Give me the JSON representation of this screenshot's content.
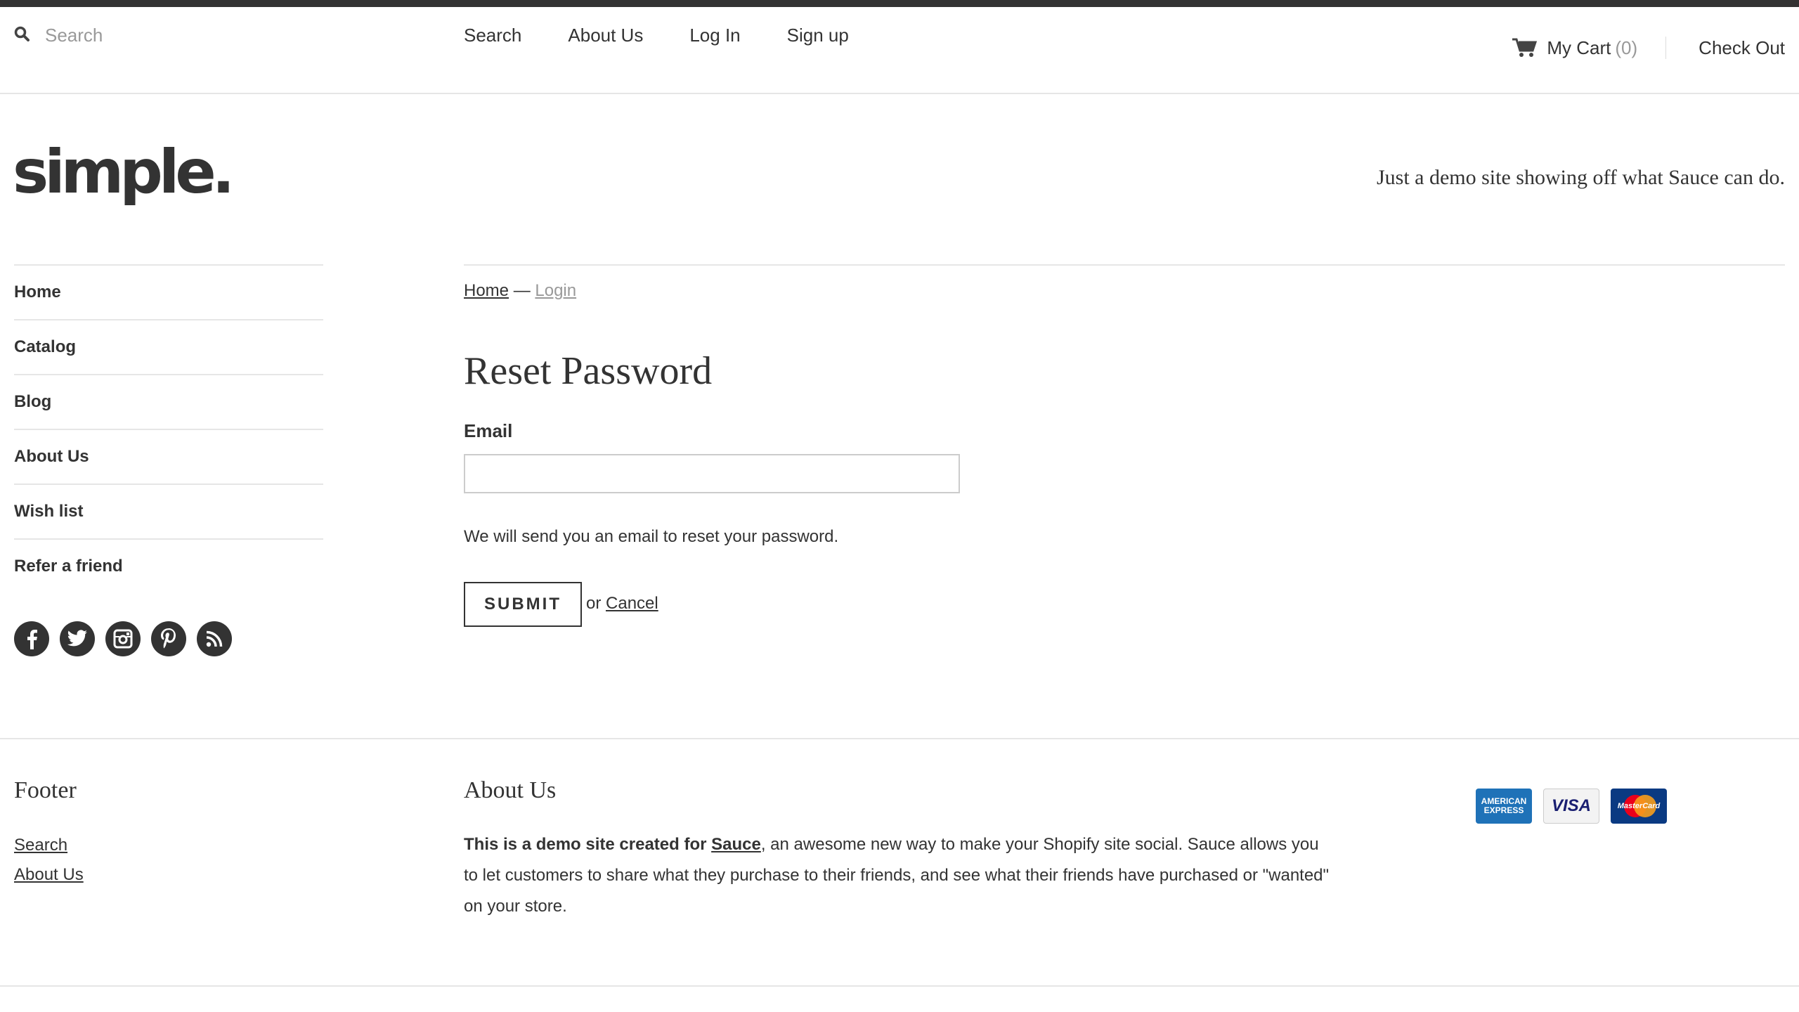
{
  "header": {
    "search_placeholder": "Search",
    "nav": [
      "Search",
      "About Us",
      "Log In",
      "Sign up"
    ],
    "cart_label": "My Cart",
    "cart_count": "(0)",
    "checkout_label": "Check Out"
  },
  "brand": {
    "logo_text": "simple.",
    "tagline": "Just a demo site showing off what Sauce can do."
  },
  "sidebar": {
    "items": [
      "Home",
      "Catalog",
      "Blog",
      "About Us",
      "Wish list",
      "Refer a friend"
    ],
    "social_icons": [
      "facebook-icon",
      "twitter-icon",
      "instagram-icon",
      "pinterest-icon",
      "rss-icon"
    ]
  },
  "main": {
    "breadcrumb_home": "Home",
    "breadcrumb_sep": "—",
    "breadcrumb_current": "Login",
    "title": "Reset Password",
    "email_label": "Email",
    "email_value": "",
    "help_text": "We will send you an email to reset your password.",
    "submit_label": "SUBMIT",
    "or_text": "or",
    "cancel_label": "Cancel"
  },
  "footer": {
    "col1_title": "Footer",
    "col1_links": [
      "Search",
      "About Us"
    ],
    "col2_title": "About Us",
    "about_bold_prefix": "This is a demo site created for",
    "about_link": "Sauce",
    "about_rest": ", an awesome new way to make your Shopify site social. Sauce allows you to let customers to share what they purchase to their friends, and see what their friends have purchased or \"wanted\" on your store.",
    "payment_cards": [
      {
        "name": "American Express",
        "label_line1": "AMERICAN",
        "label_line2": "EXPRESS"
      },
      {
        "name": "Visa",
        "label": "VISA"
      },
      {
        "name": "MasterCard",
        "label": "MasterCard"
      }
    ]
  },
  "colors": {
    "text": "#333333",
    "muted": "#999999",
    "divider": "#e6e6e6",
    "top_stripe": "#333333"
  }
}
